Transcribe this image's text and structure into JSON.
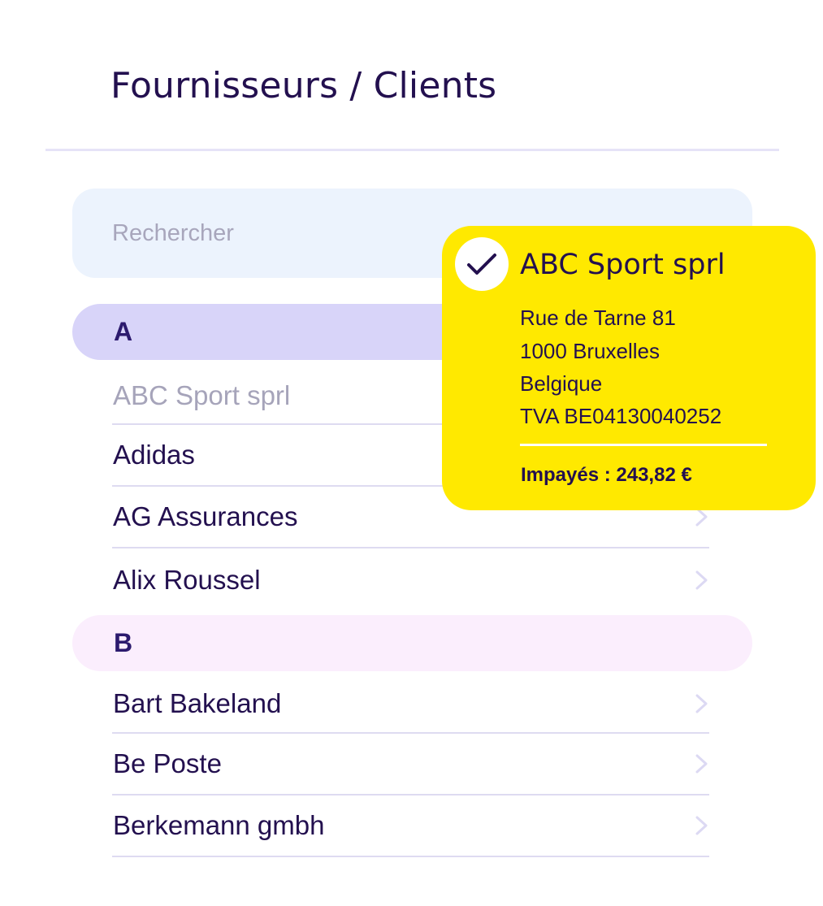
{
  "header": {
    "title": "Fournisseurs / Clients"
  },
  "search": {
    "placeholder": "Rechercher"
  },
  "sections": [
    {
      "letter": "A",
      "items": [
        {
          "label": "ABC Sport sprl",
          "selected": true
        },
        {
          "label": "Adidas"
        },
        {
          "label": "AG Assurances"
        },
        {
          "label": "Alix Roussel"
        }
      ]
    },
    {
      "letter": "B",
      "items": [
        {
          "label": "Bart Bakeland"
        },
        {
          "label": "Be Poste"
        },
        {
          "label": "Berkemann gmbh"
        }
      ]
    }
  ],
  "detail_card": {
    "name": "ABC Sport sprl",
    "address_lines": [
      "Rue de Tarne 81",
      "1000 Bruxelles",
      "Belgique",
      "TVA BE04130040252"
    ],
    "unpaid": "Impayés : 243,82 €",
    "icon": "check-icon"
  },
  "colors": {
    "text": "#23104f",
    "section_a": "#d8d4f9",
    "section_b": "#fbeefd",
    "search_bg": "#ecf3fd",
    "card_bg": "#ffe900",
    "muted_text": "#a6a4ba"
  },
  "icons": {
    "row_chevron": "chevron-right-icon"
  }
}
